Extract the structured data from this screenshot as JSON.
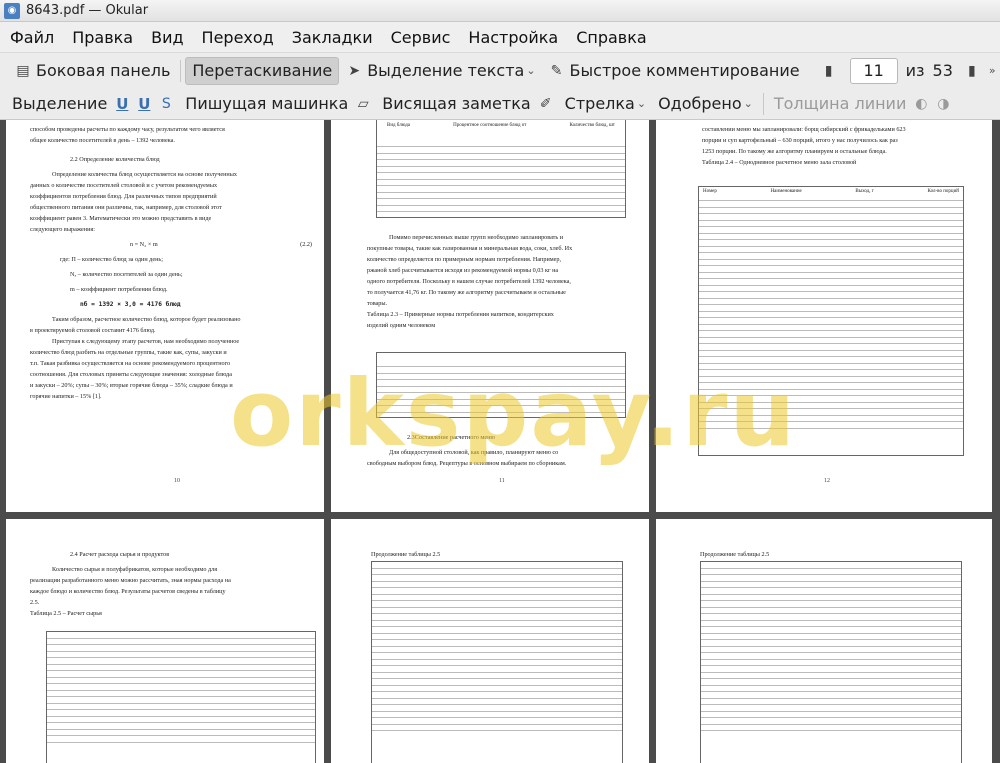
{
  "window": {
    "title": "8643.pdf — Okular"
  },
  "menu": [
    "Файл",
    "Правка",
    "Вид",
    "Переход",
    "Закладки",
    "Сервис",
    "Настройка",
    "Справка"
  ],
  "toolbar1": {
    "sidebar": "Боковая панель",
    "drag": "Перетаскивание",
    "text_select": "Выделение текста",
    "quick_comment": "Быстрое комментирование",
    "current_page": "11",
    "of_label": "из",
    "total_pages": "53"
  },
  "toolbar2": {
    "highlight": "Выделение",
    "typewriter": "Пишущая машинка",
    "popup_note": "Висящая заметка",
    "arrow": "Стрелка",
    "approved": "Одобрено",
    "line_width": "Толщина линии"
  },
  "pages": {
    "p10": {
      "lines": [
        "способом проведены расчеты по каждому часу, результатом чего является",
        "общее количество посетителей в день – 1392 человека.",
        "2.2  Определение количества блюд",
        "Определение количества блюд осуществляется на основе полученных",
        "данных о количестве посетителей столовой и с учетом рекомендуемых",
        "коэффициентов потребления блюд. Для различных типов предприятий",
        "общественного питания они различны, так, например, для столовой этот",
        "коэффициент равен 3. Математически это можно представить в виде",
        "следующего выражения:",
        "n = N₂ × m",
        "(2.2)",
        "где: П – количество блюд за один день;",
        "Nₓ – количество посетителей за один день;",
        "m – коэффициент потребления блюд.",
        "nб = 1392 × 3,0 = 4176 блюд",
        "Таким образом, расчетное количество блюд, которое будет реализовано",
        "в проектируемой столовой составит 4176 блюд.",
        "Приступая к следующему этапу расчетов, нам необходимо полученное",
        "количество блюд разбить на отдельные группы, такие как, супы, закуски и",
        "т.п. Такая разбивка осуществляется на основе рекомендуемого процентного",
        "соотношения. Для столовых приняты следующие значения: холодные блюда",
        "и закуски – 20%; супы – 30%; вторые горячие блюда – 35%; сладкие блюда и",
        "горячие напитки – 15% [1]."
      ],
      "number": "10"
    },
    "p11": {
      "table_head": [
        "Вид блюда",
        "Процентное соотношение блюд от",
        "Количество блюд, шт"
      ],
      "lines": [
        "Помимо перечисленных выше групп необходимо запланировать и",
        "покупные товары, такие как газированная и минеральная вода, соки, хлеб. Их",
        "количество определяется по примерным нормам потребления. Например,",
        "ржаной хлеб рассчитывается исходя из рекомендуемой нормы 0,03 кг на",
        "одного потребителя. Поскольку в нашем случае потребителей 1392 человека,",
        "то получается 41,76 кг. По такому же алгоритму рассчитываем и остальные",
        "товары.",
        "Таблица 2.3 – Примерные нормы потребления напитков, кондитерских",
        "изделий одним человеком",
        "2.3Составление расчетного меню",
        "Для общедоступной столовой, как правило, планируют меню со",
        "свободным выбором блюд. Рецептуры в основном выбираем по сборникам."
      ],
      "number": "11"
    },
    "p12": {
      "lines": [
        "составлении меню мы запланировали: борщ сибирский с фрикадельками 623",
        "порции и суп картофельный – 630 порций, итого у нас получилось как раз",
        "1253 порции. По такому же алгоритму планируем и остальные блюда.",
        "Таблица 2.4 – Однодневное расчетное меню зала столовой"
      ],
      "table_head": [
        "Номер",
        "Наименование",
        "Выход, г",
        "Кол-во порций"
      ],
      "number": "12"
    },
    "p13": {
      "lines": [
        "2.4 Расчет расхода сырья и продуктов",
        "Количество сырья и полуфабрикатов, которые необходимо для",
        "реализации разработанного меню можно рассчитать, зная нормы расхода на",
        "каждое блюдо и количество блюд. Результаты расчетов сведены в таблицу",
        "2.5.",
        "Таблица 2.5 – Расчет сырья"
      ]
    },
    "p14": {
      "caption": "Продолжение таблицы 2.5"
    },
    "p15": {
      "caption": "Продолжение таблицы 2.5"
    }
  },
  "watermark": "orkspay.ru"
}
